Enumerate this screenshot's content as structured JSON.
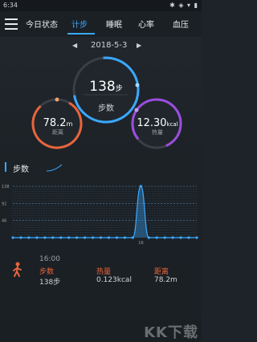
{
  "status_bar": {
    "time": "6:34",
    "icons": "✱ ◈ ▾ ▮"
  },
  "nav": {
    "tabs": [
      {
        "label": "今日状态"
      },
      {
        "label": "计步"
      },
      {
        "label": "睡眠"
      },
      {
        "label": "心率"
      },
      {
        "label": "血压"
      }
    ],
    "active_index": 1
  },
  "date_nav": {
    "prev": "◀",
    "date": "2018-5-3",
    "next": "▶"
  },
  "steps_ring": {
    "value": "138",
    "unit": "步",
    "label": "步数",
    "color": "#3aa8ff"
  },
  "distance_ring": {
    "value": "78.2",
    "unit": "m",
    "label": "距离",
    "color": "#e8643a"
  },
  "calorie_ring": {
    "value": "12.30",
    "unit": "kcal",
    "label": "热量",
    "color": "#9b4de0"
  },
  "section": {
    "title": "步数"
  },
  "chart_data": {
    "type": "area",
    "title": "",
    "xlabel": "",
    "ylabel": "",
    "y_ticks": [
      "138",
      "92",
      "46"
    ],
    "x_ticks": [
      "16"
    ],
    "ylim": [
      0,
      138
    ],
    "x": [
      0,
      1,
      2,
      3,
      4,
      5,
      6,
      7,
      8,
      9,
      10,
      11,
      12,
      13,
      14,
      15,
      16,
      17,
      18,
      19,
      20,
      21,
      22,
      23
    ],
    "values": [
      0,
      0,
      0,
      0,
      0,
      0,
      0,
      0,
      0,
      0,
      0,
      0,
      0,
      0,
      0,
      0,
      138,
      0,
      0,
      0,
      0,
      0,
      0,
      0
    ],
    "grid": true,
    "color": "#3aa8ff"
  },
  "detail": {
    "time": "16:00",
    "columns": [
      {
        "label": "步数",
        "value": "138步"
      },
      {
        "label": "热量",
        "value": "0.123kcal"
      },
      {
        "label": "距离",
        "value": "78.2m"
      }
    ],
    "label_color": "#e8643a"
  },
  "watermark": "KK下载"
}
